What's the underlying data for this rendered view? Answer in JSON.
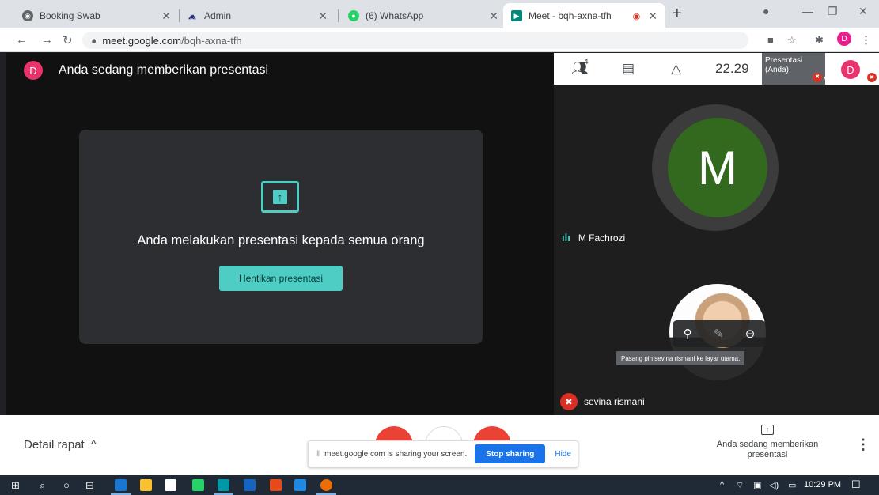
{
  "browser": {
    "tabs": [
      {
        "title": "Booking Swab",
        "favicon": "globe-icon"
      },
      {
        "title": "Admin",
        "favicon": "admin-logo-icon"
      },
      {
        "title": "(6) WhatsApp",
        "favicon": "whatsapp-icon"
      },
      {
        "title": "Meet - bqh-axna-tfh",
        "favicon": "meet-icon",
        "active": true
      }
    ],
    "url_host": "meet.google.com",
    "url_path": "/bqh-axna-tfh",
    "profile_initial": "D"
  },
  "stage": {
    "presenter_initial": "D",
    "header_text": "Anda sedang memberikan presentasi",
    "message": "Anda melakukan presentasi kepada semua orang",
    "stop_button": "Hentikan presentasi"
  },
  "panel": {
    "people_count": "4",
    "clock": "22.29",
    "self_thumb_label": "Presentasi (Anda)",
    "self_label": "Anda",
    "self_initial": "D",
    "participants": [
      {
        "name": "M Fachrozi",
        "initial": "M",
        "avatar_color": "#33691e"
      },
      {
        "name": "sevina rismani"
      }
    ],
    "tooltip": "Pasang pin sevina rismani ke layar utama."
  },
  "bottom": {
    "detail_label": "Detail rapat",
    "share_message": "meet.google.com is sharing your screen.",
    "stop_sharing": "Stop sharing",
    "hide": "Hide",
    "presenting_status": "Anda sedang memberikan presentasi"
  },
  "taskbar": {
    "time": "10:29 PM"
  },
  "colors": {
    "accent": "#4ecdc4",
    "danger": "#d93025",
    "link": "#1a73e8"
  }
}
